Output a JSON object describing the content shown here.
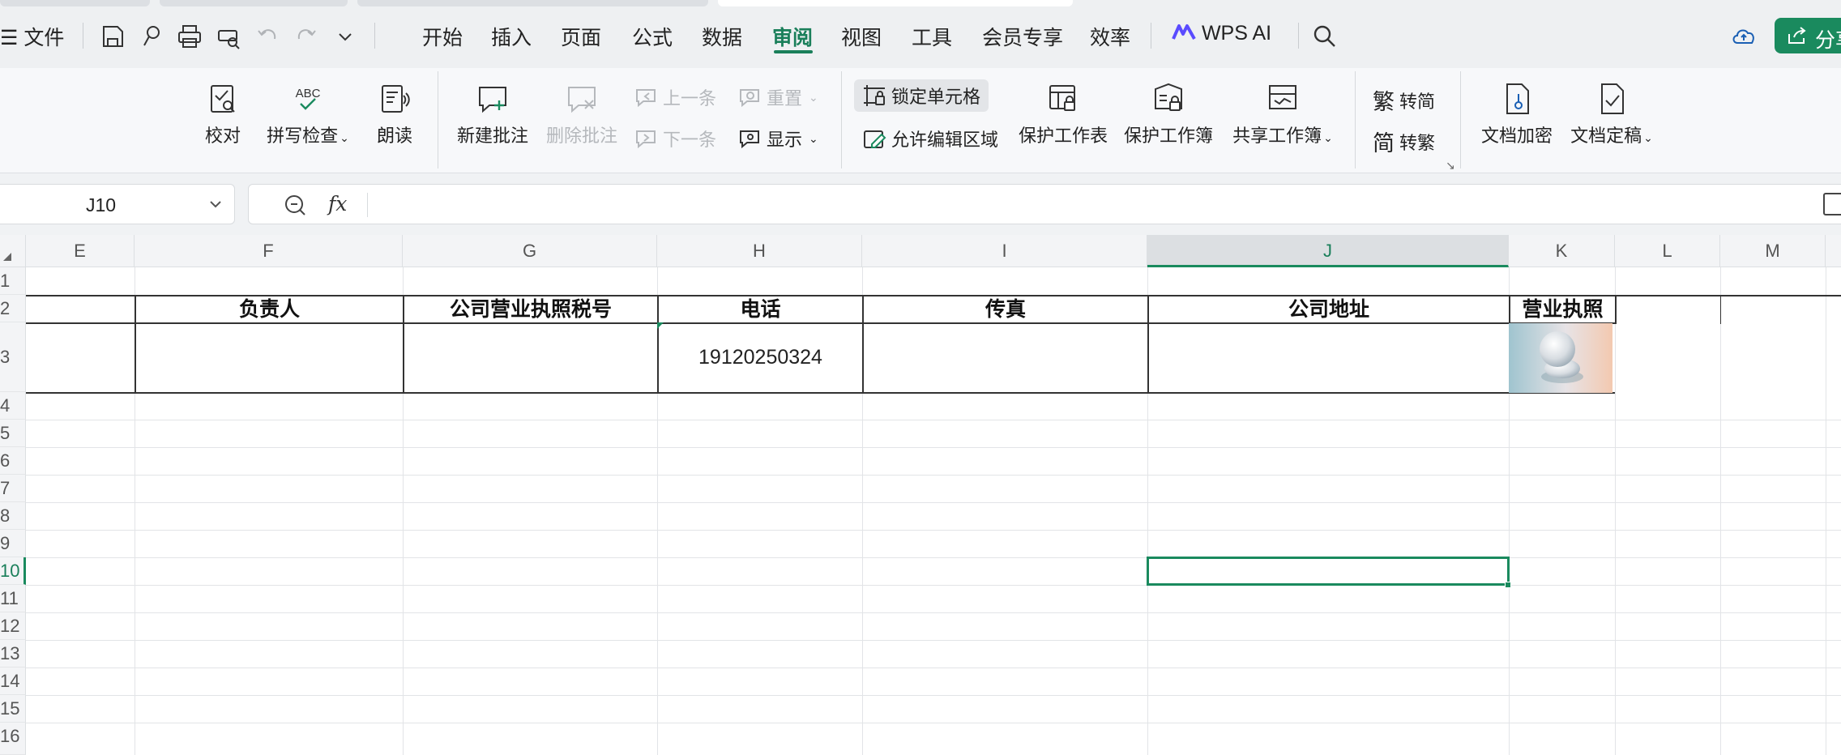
{
  "menubar": {
    "file_label": "文件",
    "tabs": [
      {
        "label": "开始"
      },
      {
        "label": "插入"
      },
      {
        "label": "页面"
      },
      {
        "label": "公式"
      },
      {
        "label": "数据"
      },
      {
        "label": "审阅"
      },
      {
        "label": "视图"
      },
      {
        "label": "工具"
      },
      {
        "label": "会员专享"
      },
      {
        "label": "效率"
      }
    ],
    "active_tab": "审阅",
    "wps_ai_label": "WPS AI",
    "share_label": "分享"
  },
  "ribbon": {
    "proofread": "校对",
    "spell_check": "拼写检查",
    "read_aloud": "朗读",
    "new_comment": "新建批注",
    "delete_comment": "删除批注",
    "prev_item": "上一条",
    "next_item": "下一条",
    "reset": "重置",
    "show": "显示",
    "lock_cells": "锁定单元格",
    "allow_edit_ranges": "允许编辑区域",
    "protect_sheet": "保护工作表",
    "protect_workbook": "保护工作簿",
    "share_workbook": "共享工作簿",
    "to_simplified": "转简",
    "to_traditional": "转繁",
    "doc_encrypt": "文档加密",
    "doc_finalize": "文档定稿",
    "abc_glyph": "ABC",
    "fan_glyph": "繁",
    "jian_glyph": "简"
  },
  "formula_bar": {
    "name_box": "J10",
    "fx_label": "fx",
    "formula_value": ""
  },
  "grid": {
    "columns": [
      "E",
      "F",
      "G",
      "H",
      "I",
      "J",
      "K",
      "L",
      "M"
    ],
    "selected_column": "J",
    "rows": [
      "1",
      "2",
      "3",
      "4",
      "5",
      "6",
      "7",
      "8",
      "9",
      "10",
      "11",
      "12",
      "13",
      "14",
      "15",
      "16"
    ],
    "selected_row": "10",
    "header_row": {
      "E": "",
      "F": "负责人",
      "G": "公司营业执照税号",
      "H": "电话",
      "I": "传真",
      "J": "公司地址",
      "K": "营业执照"
    },
    "data_row": {
      "H": "19120250324"
    },
    "selected_cell": "J10",
    "accent_color": "#1a8a5e"
  }
}
